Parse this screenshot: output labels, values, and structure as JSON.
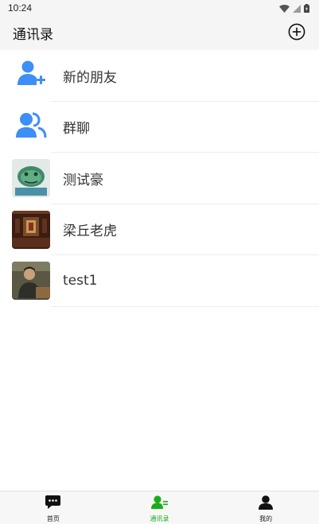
{
  "status_bar": {
    "time": "10:24",
    "icons": [
      "wifi-icon",
      "signal-icon",
      "battery-icon"
    ]
  },
  "header": {
    "title": "通讯录",
    "add_icon": "plus-circle-icon"
  },
  "contacts": [
    {
      "name": "新的朋友",
      "avatar": "add-friend-icon"
    },
    {
      "name": "群聊",
      "avatar": "group-chat-icon"
    },
    {
      "name": "测试豪",
      "avatar": "photo-green-creature"
    },
    {
      "name": "梁丘老虎",
      "avatar": "photo-room"
    },
    {
      "name": "test1",
      "avatar": "photo-person"
    }
  ],
  "bottom_nav": {
    "items": [
      {
        "label": "首页",
        "icon": "chat-bubble-icon",
        "active": false
      },
      {
        "label": "通讯录",
        "icon": "contacts-icon",
        "active": true
      },
      {
        "label": "我的",
        "icon": "person-icon",
        "active": false
      }
    ]
  },
  "colors": {
    "accent_blue": "#3e8ef7",
    "active_green": "#1aad19",
    "header_bg": "#f5f5f5"
  }
}
